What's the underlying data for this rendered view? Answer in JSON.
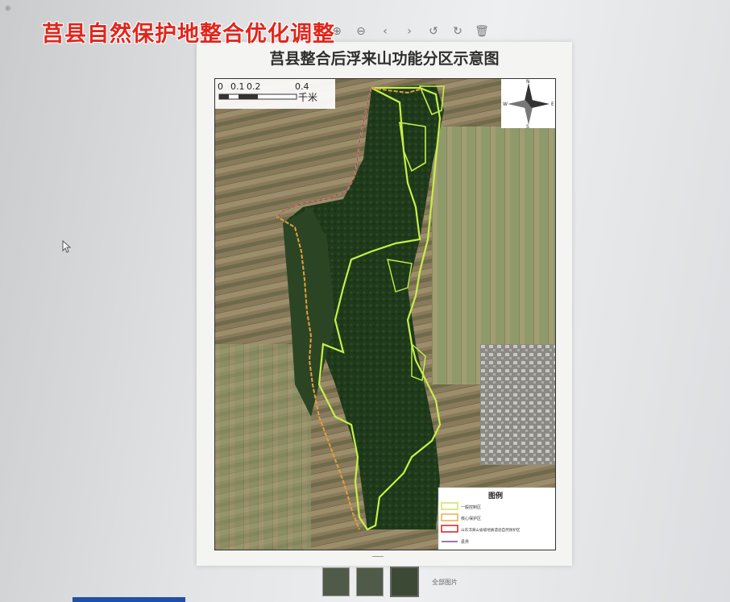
{
  "watermark": "莒县自然保护地整合优化调整",
  "viewer": {
    "corner_text": "⊕",
    "toolbar": [
      {
        "name": "zoom-in-icon",
        "glyph": "⊕"
      },
      {
        "name": "zoom-out-icon",
        "glyph": "⊖"
      },
      {
        "name": "prev-icon",
        "glyph": "‹"
      },
      {
        "name": "next-icon",
        "glyph": "›"
      },
      {
        "name": "rotate-left-icon",
        "glyph": "↺"
      },
      {
        "name": "rotate-right-icon",
        "glyph": "↻"
      },
      {
        "name": "delete-icon",
        "glyph": "🗑"
      }
    ],
    "thumbs_label": "全部图片"
  },
  "map": {
    "title": "莒县整合后浮来山功能分区示意图",
    "scale_labels": [
      "0",
      "0.1",
      "0.2",
      "0.4"
    ],
    "scale_unit": "千米",
    "compass": {
      "n": "N",
      "s": "S",
      "e": "E",
      "w": "W"
    },
    "legend": {
      "title": "图例",
      "items": [
        {
          "label": "一般控制区",
          "color": "#cfe25a",
          "type": "box"
        },
        {
          "label": "核心保护区",
          "color": "#e8b14a",
          "type": "box"
        },
        {
          "label": "山东浮来山省级地质遗迹自然保护区",
          "color": "#d02020",
          "type": "box"
        },
        {
          "label": "县界",
          "color": "#7b4a8c",
          "type": "line"
        }
      ]
    },
    "colors": {
      "boundary": "#c6f04a",
      "county_line": "#e0a040",
      "forest": "#1f3a1a"
    }
  }
}
